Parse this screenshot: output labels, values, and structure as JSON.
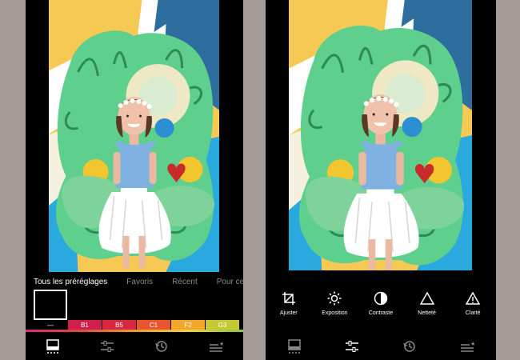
{
  "left_screen": {
    "preset_tabs": [
      {
        "label": "Tous les préréglages",
        "active": true
      },
      {
        "label": "Favoris",
        "active": false
      },
      {
        "label": "Récent",
        "active": false
      },
      {
        "label": "Pour cette photo",
        "active": false
      }
    ],
    "presets": [
      {
        "label": "—",
        "filter": "none",
        "color": "#000000",
        "selected": true
      },
      {
        "label": "B1",
        "filter": "grayscale",
        "color": "#d01f4b",
        "selected": false
      },
      {
        "label": "B5",
        "filter": "grayscale",
        "color": "#d8283f",
        "selected": false
      },
      {
        "label": "C1",
        "filter": "warm",
        "color": "#e8552f",
        "selected": false
      },
      {
        "label": "F2",
        "filter": "soft",
        "color": "#f2a72b",
        "selected": false
      },
      {
        "label": "G3",
        "filter": "vivid",
        "color": "#c5c932",
        "selected": false
      }
    ]
  },
  "right_screen": {
    "tools": [
      {
        "label": "Ajuster",
        "icon": "crop-icon"
      },
      {
        "label": "Exposition",
        "icon": "sun-icon"
      },
      {
        "label": "Contraste",
        "icon": "contrast-icon"
      },
      {
        "label": "Netteté",
        "icon": "triangle-icon"
      },
      {
        "label": "Clarté",
        "icon": "triangle-exclaim-icon"
      }
    ]
  },
  "bottom_nav": {
    "items": [
      "presets-icon",
      "tools-icon",
      "history-icon",
      "recipes-icon"
    ],
    "left_active": 0,
    "right_active": 1
  },
  "colors": {
    "background": "#a59c99",
    "monster_green": "#5ecf8c",
    "sky_blue": "#2aa8dd",
    "yellow": "#f6c955",
    "dress_blue": "#7fb2e0"
  }
}
